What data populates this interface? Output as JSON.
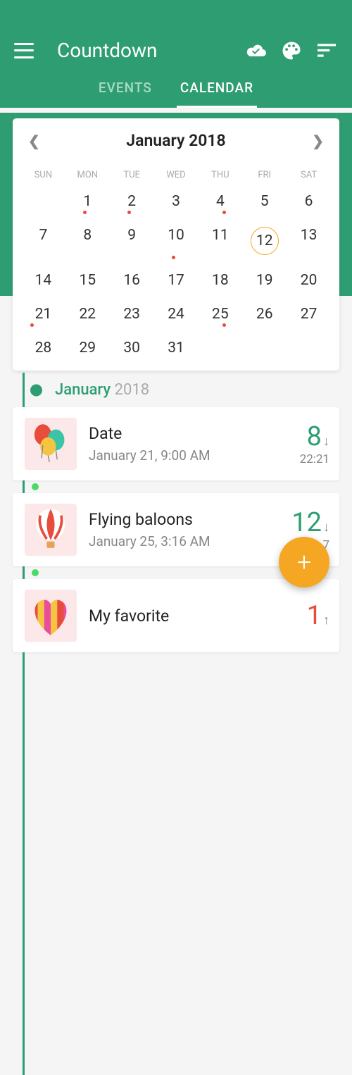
{
  "header": {
    "title": "Countdown"
  },
  "tabs": {
    "events": "EVENTS",
    "calendar": "CALENDAR"
  },
  "calendar": {
    "month_year": "January 2018",
    "weekdays": [
      "SUN",
      "MON",
      "TUE",
      "WED",
      "THU",
      "FRI",
      "SAT"
    ],
    "today": 12,
    "dotted": [
      1,
      2,
      4,
      10,
      21,
      25
    ]
  },
  "timeline": {
    "month": "January",
    "year": "2018"
  },
  "events": [
    {
      "title": "Date",
      "datetime": "January 21, 9:00 AM",
      "count": "8",
      "direction": "↓",
      "time_left": "22:21",
      "icon": "balloons"
    },
    {
      "title": "Flying baloons",
      "datetime": "January 25, 3:16 AM",
      "count": "12",
      "direction": "↓",
      "time_left": "7",
      "icon": "hot-air-balloon"
    },
    {
      "title": "My favorite",
      "datetime": "",
      "count": "1",
      "direction": "↑",
      "time_left": "",
      "icon": "heart-stripes"
    }
  ]
}
